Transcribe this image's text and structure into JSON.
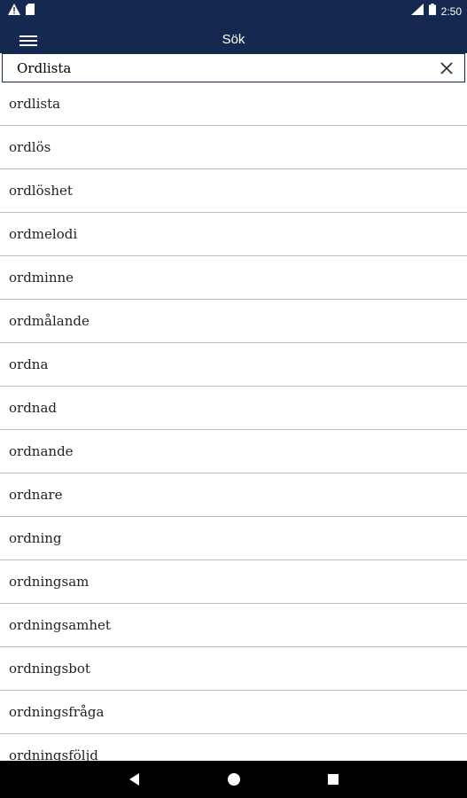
{
  "status_bar": {
    "time": "2:50",
    "left_icons": [
      "warning-icon",
      "sd-card-icon"
    ],
    "right_icons": [
      "signal-icon",
      "battery-icon"
    ]
  },
  "app_bar": {
    "title": "Sök",
    "menu_icon": "hamburger-menu-icon"
  },
  "search": {
    "value": "Ordlista",
    "clear_icon": "close-icon"
  },
  "words": [
    "ordlista",
    "ordlös",
    "ordlöshet",
    "ordmelodi",
    "ordminne",
    "ordmålande",
    "ordna",
    "ordnad",
    "ordnande",
    "ordnare",
    "ordning",
    "ordningsam",
    "ordningsamhet",
    "ordningsbot",
    "ordningsfråga",
    "ordningsföljd"
  ],
  "nav_bar": {
    "icons": [
      "back-icon",
      "home-icon",
      "recents-icon"
    ]
  },
  "colors": {
    "primary": "#15284f",
    "divider": "#bdbdbd",
    "nav_background": "#000000"
  }
}
